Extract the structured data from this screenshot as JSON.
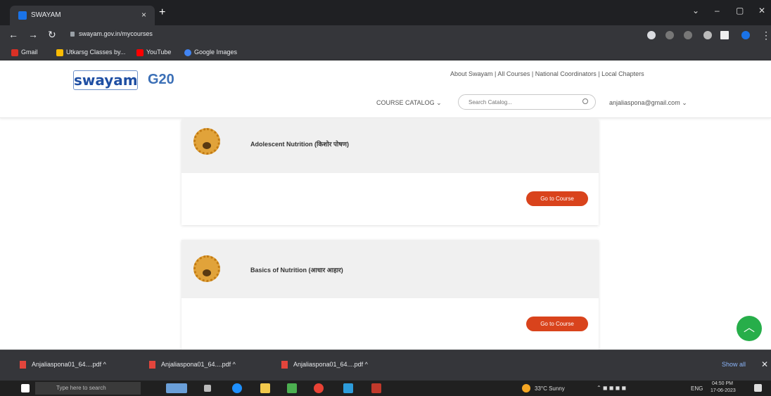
{
  "browser": {
    "tab_title": "SWAYAM",
    "tab_close": "×",
    "new_tab": "+",
    "window_controls": [
      "⌄",
      "–",
      "▢",
      "✕"
    ],
    "url": "swayam.gov.in/mycourses",
    "bookmarks": [
      {
        "label": "Gmail",
        "color": "#d93025"
      },
      {
        "label": "Utkarsg Classes by...",
        "color": "#fbbc04"
      },
      {
        "label": "YouTube",
        "color": "#ff0000"
      },
      {
        "label": "Google Images",
        "color": "#4285f4"
      }
    ]
  },
  "site": {
    "logo_text": "swayam",
    "g20_text": "G20",
    "top_links": "About Swayam | All Courses | National Coordinators | Local Chapters",
    "catalog_label": "COURSE CATALOG ⌄",
    "search_placeholder": "Search Catalog...",
    "user_email": "anjaliaspona@gmail.com ⌄"
  },
  "courses": [
    {
      "name": "Adolescent Nutrition (किशोर पोषण)",
      "button": "Go to Course"
    },
    {
      "name": "Basics of Nutrition (आधार आहार)",
      "button": "Go to Course"
    }
  ],
  "downloads": {
    "items": [
      {
        "label": "Anjaliaspona01_64....pdf  ^"
      },
      {
        "label": "Anjaliaspona01_64....pdf  ^"
      },
      {
        "label": "Anjaliaspona01_64....pdf  ^"
      }
    ],
    "show_all": "Show all",
    "close": "✕"
  },
  "taskbar": {
    "search_placeholder": "Type here to search",
    "weather": "33°C  Sunny",
    "language": "ENG",
    "time": "04:50 PM",
    "date": "17-06-2023"
  },
  "fab_icon": "chevron-up-icon"
}
